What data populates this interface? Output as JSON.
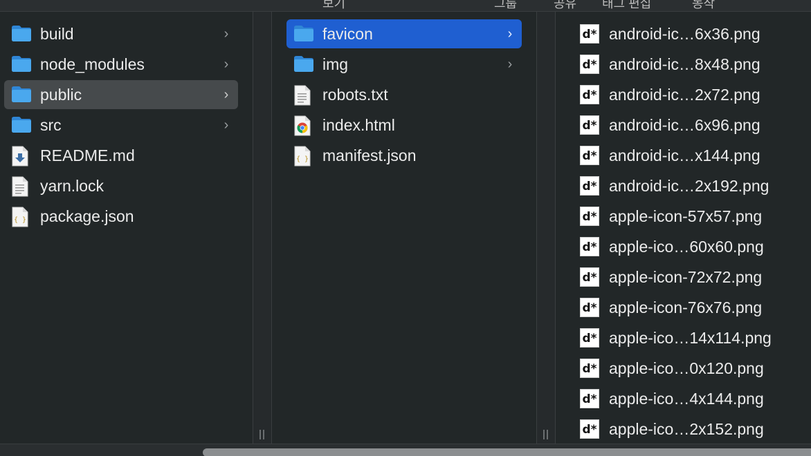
{
  "topbar": {
    "fragments": [
      "보기",
      "그룹",
      "공유",
      "태그 편집",
      "동작"
    ]
  },
  "columns": [
    {
      "items": [
        {
          "label": "build",
          "icon": "folder-icon",
          "has_children": true,
          "state": "none"
        },
        {
          "label": "node_modules",
          "icon": "folder-icon",
          "has_children": true,
          "state": "none"
        },
        {
          "label": "public",
          "icon": "folder-icon",
          "has_children": true,
          "state": "selected-inactive"
        },
        {
          "label": "src",
          "icon": "folder-icon",
          "has_children": true,
          "state": "none"
        },
        {
          "label": "README.md",
          "icon": "markdown-file-icon",
          "has_children": false,
          "state": "none"
        },
        {
          "label": "yarn.lock",
          "icon": "text-file-icon",
          "has_children": false,
          "state": "none"
        },
        {
          "label": "package.json",
          "icon": "json-file-icon",
          "has_children": false,
          "state": "none"
        }
      ]
    },
    {
      "items": [
        {
          "label": "favicon",
          "icon": "folder-icon",
          "has_children": true,
          "state": "selected-active"
        },
        {
          "label": "img",
          "icon": "folder-icon",
          "has_children": true,
          "state": "none"
        },
        {
          "label": "robots.txt",
          "icon": "text-file-icon",
          "has_children": false,
          "state": "none"
        },
        {
          "label": "index.html",
          "icon": "chrome-html-icon",
          "has_children": false,
          "state": "none"
        },
        {
          "label": "manifest.json",
          "icon": "json-file-icon",
          "has_children": false,
          "state": "none"
        }
      ]
    },
    {
      "items": [
        {
          "label": "android-ic…6x36.png",
          "icon": "png-file-icon"
        },
        {
          "label": "android-ic…8x48.png",
          "icon": "png-file-icon"
        },
        {
          "label": "android-ic…2x72.png",
          "icon": "png-file-icon"
        },
        {
          "label": "android-ic…6x96.png",
          "icon": "png-file-icon"
        },
        {
          "label": "android-ic…x144.png",
          "icon": "png-file-icon"
        },
        {
          "label": "android-ic…2x192.png",
          "icon": "png-file-icon"
        },
        {
          "label": "apple-icon-57x57.png",
          "icon": "png-file-icon"
        },
        {
          "label": "apple-ico…60x60.png",
          "icon": "png-file-icon"
        },
        {
          "label": "apple-icon-72x72.png",
          "icon": "png-file-icon"
        },
        {
          "label": "apple-icon-76x76.png",
          "icon": "png-file-icon"
        },
        {
          "label": "apple-ico…14x114.png",
          "icon": "png-file-icon"
        },
        {
          "label": "apple-ico…0x120.png",
          "icon": "png-file-icon"
        },
        {
          "label": "apple-ico…4x144.png",
          "icon": "png-file-icon"
        },
        {
          "label": "apple-ico…2x152.png",
          "icon": "png-file-icon"
        }
      ]
    }
  ],
  "png_icon_glyph": "d*",
  "json_icon_glyph": "{ }",
  "chevron_glyph": "›",
  "colors": {
    "selected_active": "#1f5fd1",
    "selected_inactive": "#464a4c",
    "folder": "#4aa3e8"
  }
}
